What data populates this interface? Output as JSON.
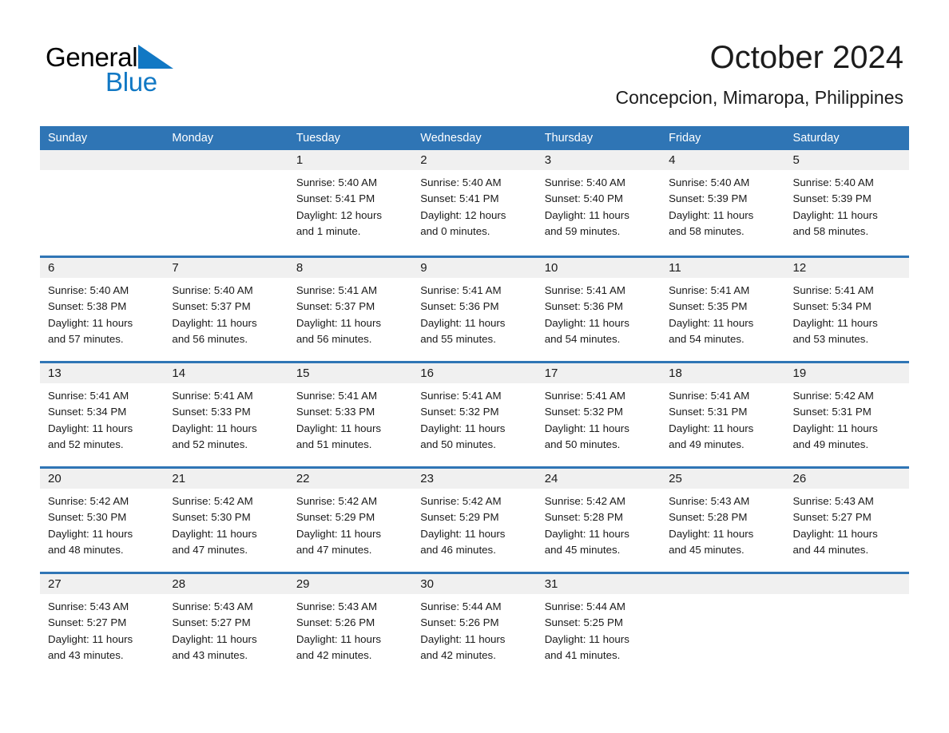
{
  "brand": {
    "name_part1": "General",
    "name_part2": "Blue",
    "triangle_color": "#1178c4",
    "accent_color": "#2f75b5"
  },
  "header": {
    "month_title": "October 2024",
    "location": "Concepcion, Mimaropa, Philippines"
  },
  "calendar": {
    "weekdays": [
      "Sunday",
      "Monday",
      "Tuesday",
      "Wednesday",
      "Thursday",
      "Friday",
      "Saturday"
    ],
    "weeks": [
      [
        {
          "day": "",
          "sunrise": "",
          "sunset": "",
          "daylight_line1": "",
          "daylight_line2": ""
        },
        {
          "day": "",
          "sunrise": "",
          "sunset": "",
          "daylight_line1": "",
          "daylight_line2": ""
        },
        {
          "day": "1",
          "sunrise": "Sunrise: 5:40 AM",
          "sunset": "Sunset: 5:41 PM",
          "daylight_line1": "Daylight: 12 hours",
          "daylight_line2": "and 1 minute."
        },
        {
          "day": "2",
          "sunrise": "Sunrise: 5:40 AM",
          "sunset": "Sunset: 5:41 PM",
          "daylight_line1": "Daylight: 12 hours",
          "daylight_line2": "and 0 minutes."
        },
        {
          "day": "3",
          "sunrise": "Sunrise: 5:40 AM",
          "sunset": "Sunset: 5:40 PM",
          "daylight_line1": "Daylight: 11 hours",
          "daylight_line2": "and 59 minutes."
        },
        {
          "day": "4",
          "sunrise": "Sunrise: 5:40 AM",
          "sunset": "Sunset: 5:39 PM",
          "daylight_line1": "Daylight: 11 hours",
          "daylight_line2": "and 58 minutes."
        },
        {
          "day": "5",
          "sunrise": "Sunrise: 5:40 AM",
          "sunset": "Sunset: 5:39 PM",
          "daylight_line1": "Daylight: 11 hours",
          "daylight_line2": "and 58 minutes."
        }
      ],
      [
        {
          "day": "6",
          "sunrise": "Sunrise: 5:40 AM",
          "sunset": "Sunset: 5:38 PM",
          "daylight_line1": "Daylight: 11 hours",
          "daylight_line2": "and 57 minutes."
        },
        {
          "day": "7",
          "sunrise": "Sunrise: 5:40 AM",
          "sunset": "Sunset: 5:37 PM",
          "daylight_line1": "Daylight: 11 hours",
          "daylight_line2": "and 56 minutes."
        },
        {
          "day": "8",
          "sunrise": "Sunrise: 5:41 AM",
          "sunset": "Sunset: 5:37 PM",
          "daylight_line1": "Daylight: 11 hours",
          "daylight_line2": "and 56 minutes."
        },
        {
          "day": "9",
          "sunrise": "Sunrise: 5:41 AM",
          "sunset": "Sunset: 5:36 PM",
          "daylight_line1": "Daylight: 11 hours",
          "daylight_line2": "and 55 minutes."
        },
        {
          "day": "10",
          "sunrise": "Sunrise: 5:41 AM",
          "sunset": "Sunset: 5:36 PM",
          "daylight_line1": "Daylight: 11 hours",
          "daylight_line2": "and 54 minutes."
        },
        {
          "day": "11",
          "sunrise": "Sunrise: 5:41 AM",
          "sunset": "Sunset: 5:35 PM",
          "daylight_line1": "Daylight: 11 hours",
          "daylight_line2": "and 54 minutes."
        },
        {
          "day": "12",
          "sunrise": "Sunrise: 5:41 AM",
          "sunset": "Sunset: 5:34 PM",
          "daylight_line1": "Daylight: 11 hours",
          "daylight_line2": "and 53 minutes."
        }
      ],
      [
        {
          "day": "13",
          "sunrise": "Sunrise: 5:41 AM",
          "sunset": "Sunset: 5:34 PM",
          "daylight_line1": "Daylight: 11 hours",
          "daylight_line2": "and 52 minutes."
        },
        {
          "day": "14",
          "sunrise": "Sunrise: 5:41 AM",
          "sunset": "Sunset: 5:33 PM",
          "daylight_line1": "Daylight: 11 hours",
          "daylight_line2": "and 52 minutes."
        },
        {
          "day": "15",
          "sunrise": "Sunrise: 5:41 AM",
          "sunset": "Sunset: 5:33 PM",
          "daylight_line1": "Daylight: 11 hours",
          "daylight_line2": "and 51 minutes."
        },
        {
          "day": "16",
          "sunrise": "Sunrise: 5:41 AM",
          "sunset": "Sunset: 5:32 PM",
          "daylight_line1": "Daylight: 11 hours",
          "daylight_line2": "and 50 minutes."
        },
        {
          "day": "17",
          "sunrise": "Sunrise: 5:41 AM",
          "sunset": "Sunset: 5:32 PM",
          "daylight_line1": "Daylight: 11 hours",
          "daylight_line2": "and 50 minutes."
        },
        {
          "day": "18",
          "sunrise": "Sunrise: 5:41 AM",
          "sunset": "Sunset: 5:31 PM",
          "daylight_line1": "Daylight: 11 hours",
          "daylight_line2": "and 49 minutes."
        },
        {
          "day": "19",
          "sunrise": "Sunrise: 5:42 AM",
          "sunset": "Sunset: 5:31 PM",
          "daylight_line1": "Daylight: 11 hours",
          "daylight_line2": "and 49 minutes."
        }
      ],
      [
        {
          "day": "20",
          "sunrise": "Sunrise: 5:42 AM",
          "sunset": "Sunset: 5:30 PM",
          "daylight_line1": "Daylight: 11 hours",
          "daylight_line2": "and 48 minutes."
        },
        {
          "day": "21",
          "sunrise": "Sunrise: 5:42 AM",
          "sunset": "Sunset: 5:30 PM",
          "daylight_line1": "Daylight: 11 hours",
          "daylight_line2": "and 47 minutes."
        },
        {
          "day": "22",
          "sunrise": "Sunrise: 5:42 AM",
          "sunset": "Sunset: 5:29 PM",
          "daylight_line1": "Daylight: 11 hours",
          "daylight_line2": "and 47 minutes."
        },
        {
          "day": "23",
          "sunrise": "Sunrise: 5:42 AM",
          "sunset": "Sunset: 5:29 PM",
          "daylight_line1": "Daylight: 11 hours",
          "daylight_line2": "and 46 minutes."
        },
        {
          "day": "24",
          "sunrise": "Sunrise: 5:42 AM",
          "sunset": "Sunset: 5:28 PM",
          "daylight_line1": "Daylight: 11 hours",
          "daylight_line2": "and 45 minutes."
        },
        {
          "day": "25",
          "sunrise": "Sunrise: 5:43 AM",
          "sunset": "Sunset: 5:28 PM",
          "daylight_line1": "Daylight: 11 hours",
          "daylight_line2": "and 45 minutes."
        },
        {
          "day": "26",
          "sunrise": "Sunrise: 5:43 AM",
          "sunset": "Sunset: 5:27 PM",
          "daylight_line1": "Daylight: 11 hours",
          "daylight_line2": "and 44 minutes."
        }
      ],
      [
        {
          "day": "27",
          "sunrise": "Sunrise: 5:43 AM",
          "sunset": "Sunset: 5:27 PM",
          "daylight_line1": "Daylight: 11 hours",
          "daylight_line2": "and 43 minutes."
        },
        {
          "day": "28",
          "sunrise": "Sunrise: 5:43 AM",
          "sunset": "Sunset: 5:27 PM",
          "daylight_line1": "Daylight: 11 hours",
          "daylight_line2": "and 43 minutes."
        },
        {
          "day": "29",
          "sunrise": "Sunrise: 5:43 AM",
          "sunset": "Sunset: 5:26 PM",
          "daylight_line1": "Daylight: 11 hours",
          "daylight_line2": "and 42 minutes."
        },
        {
          "day": "30",
          "sunrise": "Sunrise: 5:44 AM",
          "sunset": "Sunset: 5:26 PM",
          "daylight_line1": "Daylight: 11 hours",
          "daylight_line2": "and 42 minutes."
        },
        {
          "day": "31",
          "sunrise": "Sunrise: 5:44 AM",
          "sunset": "Sunset: 5:25 PM",
          "daylight_line1": "Daylight: 11 hours",
          "daylight_line2": "and 41 minutes."
        },
        {
          "day": "",
          "sunrise": "",
          "sunset": "",
          "daylight_line1": "",
          "daylight_line2": ""
        },
        {
          "day": "",
          "sunrise": "",
          "sunset": "",
          "daylight_line1": "",
          "daylight_line2": ""
        }
      ]
    ]
  }
}
